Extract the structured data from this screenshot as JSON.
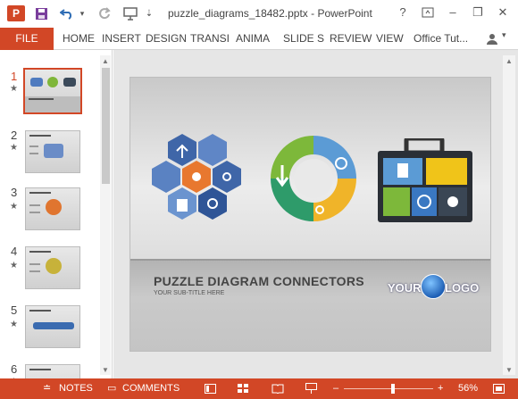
{
  "window": {
    "title": "puzzle_diagrams_18482.pptx - PowerPoint",
    "help_label": "?",
    "minimize_label": "–",
    "maximize_label": "❐",
    "close_label": "✕"
  },
  "quick_access": {
    "app_icon_label": "P",
    "save_icon": "save-icon",
    "undo_icon": "undo-icon",
    "redo_icon": "redo-icon",
    "present_icon": "present-icon",
    "customize_label": "⇣"
  },
  "ribbon": {
    "file_label": "FILE",
    "tabs": [
      {
        "label": "HOME"
      },
      {
        "label": "INSERT"
      },
      {
        "label": "DESIGN"
      },
      {
        "label": "TRANSI"
      },
      {
        "label": "ANIMA"
      },
      {
        "label": "SLIDE S"
      },
      {
        "label": "REVIEW"
      },
      {
        "label": "VIEW"
      }
    ],
    "user_label": "Office Tut..."
  },
  "thumbnails": [
    {
      "number": "1",
      "star": "★",
      "selected": true
    },
    {
      "number": "2",
      "star": "★"
    },
    {
      "number": "3",
      "star": "★"
    },
    {
      "number": "4",
      "star": "★"
    },
    {
      "number": "5",
      "star": "★"
    },
    {
      "number": "6",
      "star": "★"
    }
  ],
  "slide": {
    "title": "PUZZLE DIAGRAM CONNECTORS",
    "subtitle": "YOUR SUB-TITLE HERE",
    "logo_left": "YOUR",
    "logo_right": "LOGO"
  },
  "status_bar": {
    "notes_label": "NOTES",
    "comments_label": "COMMENTS",
    "zoom_minus": "–",
    "zoom_plus": "+",
    "zoom_value": "56%",
    "zoom_fraction": 0.56,
    "colors": {
      "accent": "#d24726"
    }
  }
}
